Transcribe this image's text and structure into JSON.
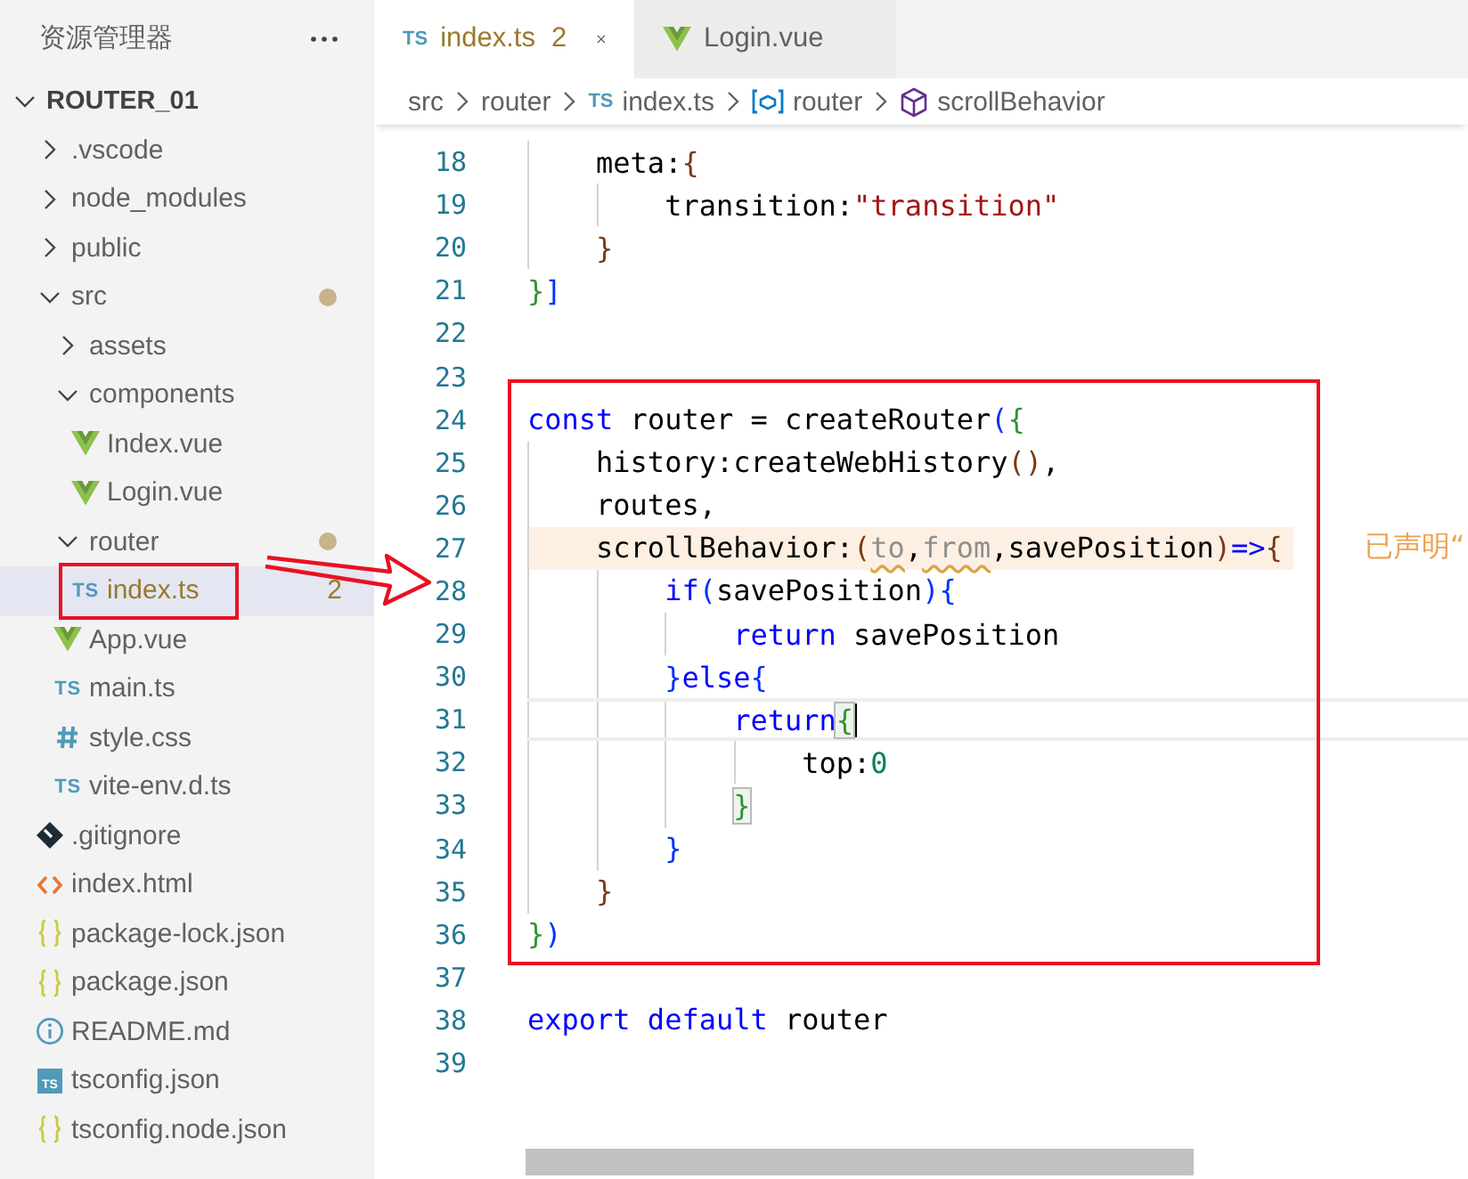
{
  "explorer": {
    "title": "资源管理器",
    "workspace": {
      "name": "ROUTER_01",
      "expanded": true,
      "children": [
        {
          "name": ".vscode",
          "kind": "folder",
          "expanded": false,
          "modified": false,
          "selected": false
        },
        {
          "name": "node_modules",
          "kind": "folder",
          "expanded": false,
          "modified": false,
          "selected": false
        },
        {
          "name": "public",
          "kind": "folder",
          "expanded": false,
          "modified": false,
          "selected": false
        },
        {
          "name": "src",
          "kind": "folder",
          "expanded": true,
          "modified": true,
          "selected": false,
          "children": [
            {
              "name": "assets",
              "kind": "folder",
              "expanded": false,
              "modified": false,
              "selected": false
            },
            {
              "name": "components",
              "kind": "folder",
              "expanded": true,
              "modified": false,
              "selected": false,
              "children": [
                {
                  "name": "Index.vue",
                  "kind": "vue",
                  "modified": false,
                  "selected": false
                },
                {
                  "name": "Login.vue",
                  "kind": "vue",
                  "modified": false,
                  "selected": false
                }
              ]
            },
            {
              "name": "router",
              "kind": "folder",
              "expanded": true,
              "modified": true,
              "selected": false,
              "children": [
                {
                  "name": "index.ts",
                  "kind": "ts",
                  "icon_text": "TS",
                  "modified": false,
                  "selected": true,
                  "problems": "2",
                  "outlined": true
                }
              ]
            },
            {
              "name": "App.vue",
              "kind": "vue",
              "modified": false,
              "selected": false
            },
            {
              "name": "main.ts",
              "kind": "ts",
              "icon_text": "TS",
              "modified": false,
              "selected": false
            },
            {
              "name": "style.css",
              "kind": "css",
              "modified": false,
              "selected": false
            },
            {
              "name": "vite-env.d.ts",
              "kind": "ts",
              "icon_text": "TS",
              "modified": false,
              "selected": false
            }
          ]
        },
        {
          "name": ".gitignore",
          "kind": "git",
          "modified": false,
          "selected": false
        },
        {
          "name": "index.html",
          "kind": "html",
          "modified": false,
          "selected": false
        },
        {
          "name": "package-lock.json",
          "kind": "json",
          "modified": false,
          "selected": false
        },
        {
          "name": "package.json",
          "kind": "json",
          "modified": false,
          "selected": false
        },
        {
          "name": "README.md",
          "kind": "info",
          "modified": false,
          "selected": false
        },
        {
          "name": "tsconfig.json",
          "kind": "tsconfig",
          "icon_text": "TS",
          "modified": false,
          "selected": false
        },
        {
          "name": "tsconfig.node.json",
          "kind": "json",
          "modified": false,
          "selected": false
        }
      ]
    }
  },
  "tabs": [
    {
      "label": "index.ts",
      "kind": "ts",
      "icon_text": "TS",
      "problems": "2",
      "selected": true
    },
    {
      "label": "Login.vue",
      "kind": "vue",
      "selected": false
    }
  ],
  "breadcrumbs": [
    {
      "label": "src",
      "kind": "folder"
    },
    {
      "label": "router",
      "kind": "folder"
    },
    {
      "label": "index.ts",
      "kind": "ts",
      "icon_text": "TS"
    },
    {
      "label": "router",
      "kind": "variable"
    },
    {
      "label": "scrollBehavior",
      "kind": "method"
    }
  ],
  "editor": {
    "blocks": [
      {
        "outlined": false,
        "lines": [
          {
            "n": "18",
            "highlighted": false,
            "current": false,
            "tokens": [
              {
                "text": "    meta:"
              },
              {
                "text": "{",
                "color": "#7b3814"
              }
            ]
          },
          {
            "n": "19",
            "highlighted": false,
            "current": false,
            "tokens": [
              {
                "text": "        transition:"
              },
              {
                "text": "\"transition\"",
                "color": "#a31515"
              }
            ]
          },
          {
            "n": "20",
            "highlighted": false,
            "current": false,
            "tokens": [
              {
                "text": "    }",
                "color": "#7b3814"
              }
            ]
          },
          {
            "n": "21",
            "highlighted": false,
            "current": false,
            "tokens": [
              {
                "text": "}",
                "color": "#319331"
              },
              {
                "text": "]",
                "color": "#0431fa"
              }
            ]
          },
          {
            "n": "22",
            "highlighted": false,
            "current": false
          },
          {
            "n": "23",
            "highlighted": false,
            "current": false
          }
        ]
      },
      {
        "outlined": true,
        "lines": [
          {
            "n": "24",
            "highlighted": false,
            "current": false,
            "tokens": [
              {
                "text": "const",
                "color": "#0000ff"
              },
              {
                "text": " router = createRouter"
              },
              {
                "text": "(",
                "color": "#0431fa"
              },
              {
                "text": "{",
                "color": "#319331"
              }
            ]
          },
          {
            "n": "25",
            "highlighted": false,
            "current": false,
            "tokens": [
              {
                "text": "    history:createWebHistory"
              },
              {
                "text": "()",
                "color": "#7b3814"
              },
              {
                "text": ","
              }
            ]
          },
          {
            "n": "26",
            "highlighted": false,
            "current": false,
            "tokens": [
              {
                "text": "    routes,"
              }
            ]
          },
          {
            "n": "27",
            "highlighted": true,
            "current": false,
            "hint": "已声明“",
            "tokens": [
              {
                "text": "    scrollBehavior:"
              },
              {
                "text": "(",
                "color": "#7b3814"
              },
              {
                "text": "to",
                "unused": true
              },
              {
                "text": ","
              },
              {
                "text": "from",
                "unused": true
              },
              {
                "text": ",savePosition"
              },
              {
                "text": ")",
                "color": "#7b3814"
              },
              {
                "text": "=>",
                "color": "#0000ff"
              },
              {
                "text": "{",
                "color": "#7b3814"
              }
            ]
          },
          {
            "n": "28",
            "highlighted": false,
            "current": false,
            "tokens": [
              {
                "text": "        if",
                "color": "#0000ff"
              },
              {
                "text": "(",
                "color": "#0431fa"
              },
              {
                "text": "savePosition"
              },
              {
                "text": ")",
                "color": "#0431fa"
              },
              {
                "text": "{",
                "color": "#0431fa"
              }
            ]
          },
          {
            "n": "29",
            "highlighted": false,
            "current": false,
            "tokens": [
              {
                "text": "            return",
                "color": "#0000ff"
              },
              {
                "text": " savePosition"
              }
            ]
          },
          {
            "n": "30",
            "highlighted": false,
            "current": false,
            "tokens": [
              {
                "text": "        }",
                "color": "#0431fa"
              },
              {
                "text": "else",
                "color": "#0000ff"
              },
              {
                "text": "{",
                "color": "#0431fa"
              }
            ]
          },
          {
            "n": "31",
            "highlighted": false,
            "current": true,
            "cursor": true,
            "tokens": [
              {
                "text": "            return",
                "color": "#0000ff"
              },
              {
                "text": "{",
                "color": "#319331",
                "boxed": true
              }
            ]
          },
          {
            "n": "32",
            "highlighted": false,
            "current": false,
            "tokens": [
              {
                "text": "                top:"
              },
              {
                "text": "0",
                "color": "#098658"
              }
            ]
          },
          {
            "n": "33",
            "highlighted": false,
            "current": false,
            "tokens": [
              {
                "text": "            }",
                "color": "#319331",
                "boxed": true
              }
            ]
          },
          {
            "n": "34",
            "highlighted": false,
            "current": false,
            "tokens": [
              {
                "text": "        }",
                "color": "#0431fa"
              }
            ]
          },
          {
            "n": "35",
            "highlighted": false,
            "current": false,
            "tokens": [
              {
                "text": "    }",
                "color": "#7b3814"
              }
            ]
          },
          {
            "n": "36",
            "highlighted": false,
            "current": false,
            "tokens": [
              {
                "text": "}",
                "color": "#319331"
              },
              {
                "text": ")",
                "color": "#0431fa"
              }
            ]
          }
        ]
      },
      {
        "outlined": false,
        "lines": [
          {
            "n": "37",
            "highlighted": false,
            "current": false
          },
          {
            "n": "38",
            "highlighted": false,
            "current": false,
            "tokens": [
              {
                "text": "export",
                "color": "#0000ff"
              },
              {
                "text": " default",
                "color": "#0000ff"
              },
              {
                "text": " router"
              }
            ]
          },
          {
            "n": "39",
            "highlighted": false,
            "current": false
          }
        ]
      }
    ]
  },
  "annotations": {
    "color": "#e81123",
    "arrow": true
  }
}
